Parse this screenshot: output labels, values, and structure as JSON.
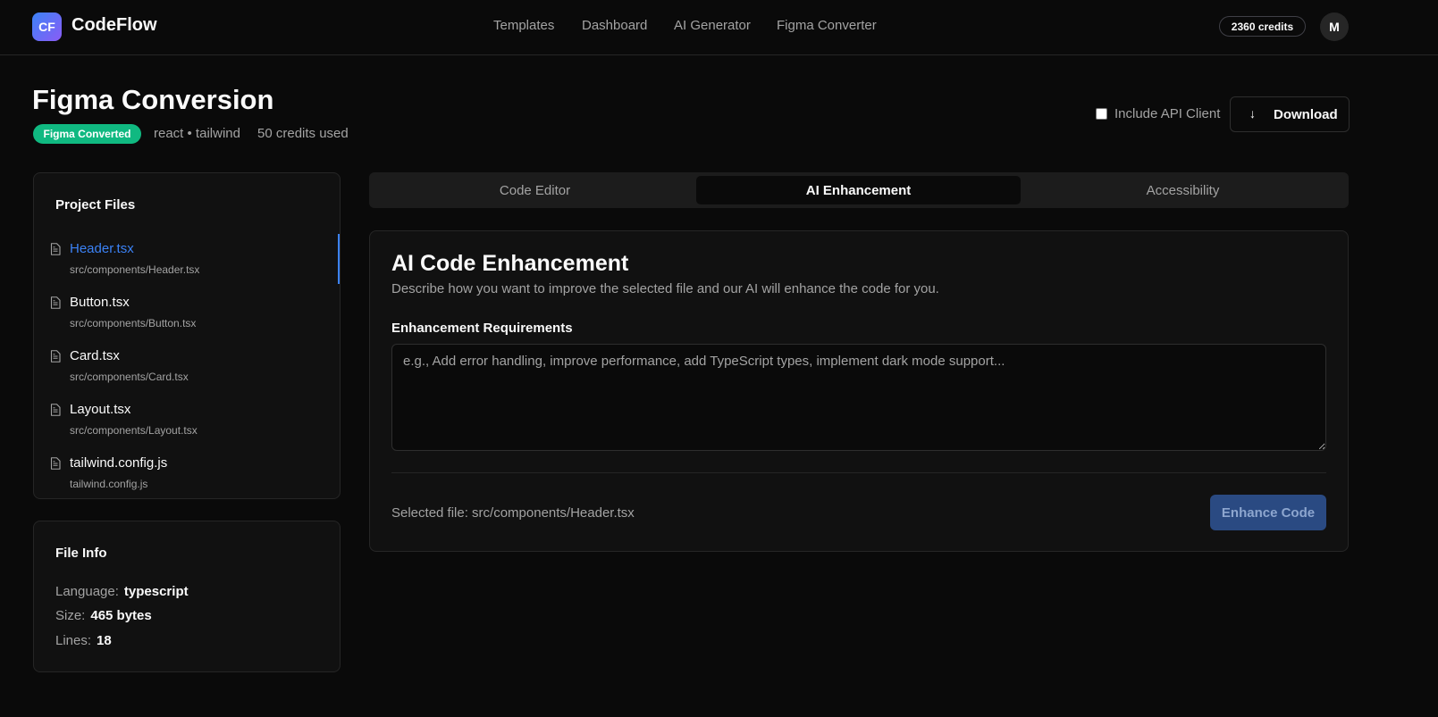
{
  "app": {
    "logo": "CF",
    "name": "CodeFlow"
  },
  "nav": {
    "items": [
      "Templates",
      "Dashboard",
      "AI Generator",
      "Figma Converter"
    ]
  },
  "user": {
    "credits": "2360 credits",
    "avatar_initial": "M"
  },
  "header": {
    "title": "Figma Conversion",
    "badge": "Figma Converted",
    "stack": "react • tailwind",
    "credits_used": "50 credits used",
    "include_api_label": "Include API Client",
    "include_api_checked": false,
    "download_label": "Download"
  },
  "project_files": {
    "title": "Project Files",
    "selected_index": 0,
    "files": [
      {
        "name": "Header.tsx",
        "path": "src/components/Header.tsx"
      },
      {
        "name": "Button.tsx",
        "path": "src/components/Button.tsx"
      },
      {
        "name": "Card.tsx",
        "path": "src/components/Card.tsx"
      },
      {
        "name": "Layout.tsx",
        "path": "src/components/Layout.tsx"
      },
      {
        "name": "tailwind.config.js",
        "path": "tailwind.config.js"
      }
    ]
  },
  "file_info": {
    "title": "File Info",
    "language_label": "Language:",
    "language": "typescript",
    "size_label": "Size:",
    "size": "465 bytes",
    "lines_label": "Lines:",
    "lines": "18"
  },
  "tabs": {
    "items": [
      "Code Editor",
      "AI Enhancement",
      "Accessibility"
    ],
    "active_index": 1
  },
  "enhancement": {
    "title": "AI Code Enhancement",
    "description": "Describe how you want to improve the selected file and our AI will enhance the code for you.",
    "requirements_label": "Enhancement Requirements",
    "requirements_value": "",
    "requirements_placeholder": "e.g., Add error handling, improve performance, add TypeScript types, implement dark mode support...",
    "selected_file": "Selected file: src/components/Header.tsx",
    "button_label": "Enhance Code"
  },
  "colors": {
    "accent": "#3b82f6",
    "badge_green": "#10b981",
    "background": "#0a0a0a",
    "card": "#111111"
  },
  "icons": {
    "file": "file-text-icon",
    "download": "arrow-down-icon"
  }
}
